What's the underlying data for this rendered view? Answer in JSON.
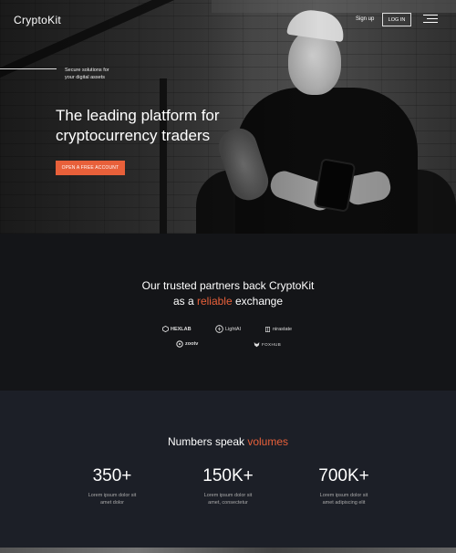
{
  "brand": {
    "name": "CryptoKit"
  },
  "nav": {
    "signup": "Sign up",
    "login": "LOG IN",
    "menu_icon": "hamburger-icon"
  },
  "hero": {
    "tagline_1": "Secure solutions for",
    "tagline_2": "your digital assets",
    "headline_1": "The leading platform for",
    "headline_2": "cryptocurrency traders",
    "cta": "OPEN A FREE ACCOUNT"
  },
  "partners": {
    "title_1": "Our trusted partners back CryptoKit",
    "title_2_pre": "as a ",
    "title_2_accent": "reliable",
    "title_2_post": " exchange",
    "logos": [
      {
        "label": "HEXLAB",
        "icon": "hex-icon"
      },
      {
        "label": "LightAI",
        "icon": "bolt-circle-icon"
      },
      {
        "label": "nirastate",
        "icon": "building-icon"
      },
      {
        "label": "zootv",
        "icon": "tv-icon"
      },
      {
        "label": "FOXHUB",
        "icon": "fox-icon"
      }
    ]
  },
  "numbers": {
    "title_pre": "Numbers speak ",
    "title_accent": "volumes",
    "stats": [
      {
        "value": "350+",
        "desc_1": "Lorem ipsum dolor sit",
        "desc_2": "amet dolor"
      },
      {
        "value": "150K+",
        "desc_1": "Lorem ipsum dolor sit",
        "desc_2": "amet, consectetur"
      },
      {
        "value": "700K+",
        "desc_1": "Lorem ipsum dolor sit",
        "desc_2": "amet adipiscing elit"
      }
    ]
  },
  "colors": {
    "accent": "#e8603a",
    "partners_bg": "#141518",
    "numbers_bg": "#1c1f27"
  }
}
